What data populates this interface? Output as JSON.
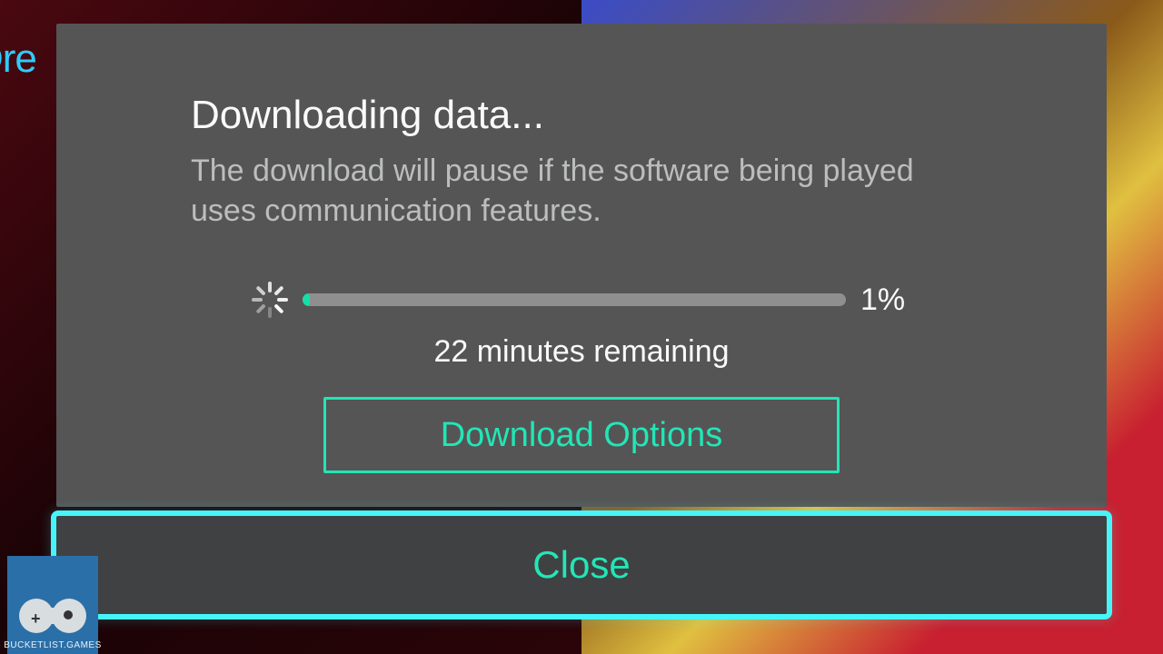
{
  "background": {
    "partial_title": "Dre"
  },
  "dialog": {
    "title": "Downloading data...",
    "subtitle": "The download will pause if the software being played uses communication features.",
    "progress": {
      "percent_label": "1%",
      "percent_value": 1,
      "time_remaining": "22 minutes remaining"
    },
    "options_button": "Download Options",
    "close_button": "Close"
  },
  "watermark": {
    "text": "BUCKETLIST.GAMES"
  },
  "colors": {
    "accent": "#22e6b6",
    "focus_ring": "#46f5f9",
    "modal_bg": "#555555",
    "close_bg": "#404143"
  }
}
